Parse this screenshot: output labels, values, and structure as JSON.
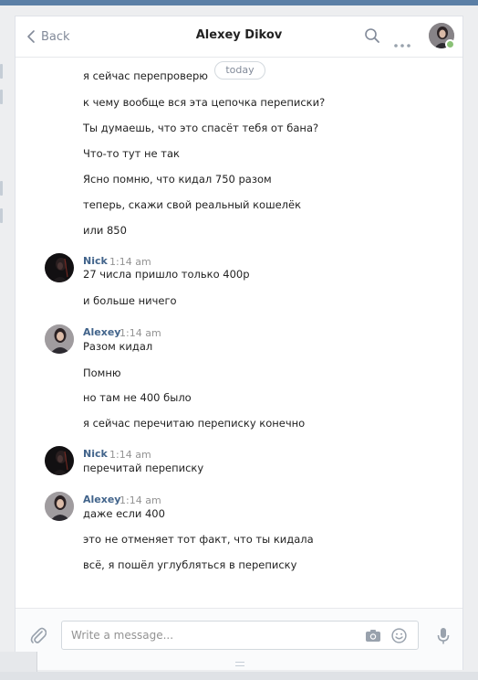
{
  "header": {
    "back_label": "Back",
    "title": "Alexey Dikov",
    "icons": [
      "search-icon",
      "more-icon",
      "avatar"
    ],
    "online": true
  },
  "history": {
    "date_pill": "today",
    "lines_top": [
      "я сейчас перепроверю",
      "к чему вообще вся эта цепочка переписки?",
      "Ты думаешь, что это спасёт тебя от бана?",
      "Что-то тут не так",
      "Ясно помню, что кидал 750 разом",
      "теперь, скажи свой реальный кошелёк",
      "или 850"
    ],
    "groups": [
      {
        "author": "Nick",
        "time": "1:14 am",
        "lines": [
          "27 числа пришло только 400р",
          "и больше ничего"
        ]
      },
      {
        "author": "Alexey",
        "time": "1:14 am",
        "lines": [
          "Разом кидал",
          "Помню",
          "но там не 400 было",
          "я сейчас перечитаю переписку конечно"
        ]
      },
      {
        "author": "Nick",
        "time": "1:14 am",
        "lines": [
          "перечитай переписку"
        ]
      },
      {
        "author": "Alexey",
        "time": "1:14 am",
        "lines": [
          "даже если 400",
          "это не отменяет тот факт, что ты кидала",
          "всё, я пошёл углубляться в переписку"
        ]
      }
    ]
  },
  "composer": {
    "placeholder": "Write a message...",
    "value": "",
    "icons": [
      "attach-icon",
      "camera-icon",
      "smile-icon",
      "microphone-icon"
    ]
  },
  "colors": {
    "author": "#42648b",
    "online": "#8ac176",
    "top_bar": "#5b7fa6"
  }
}
